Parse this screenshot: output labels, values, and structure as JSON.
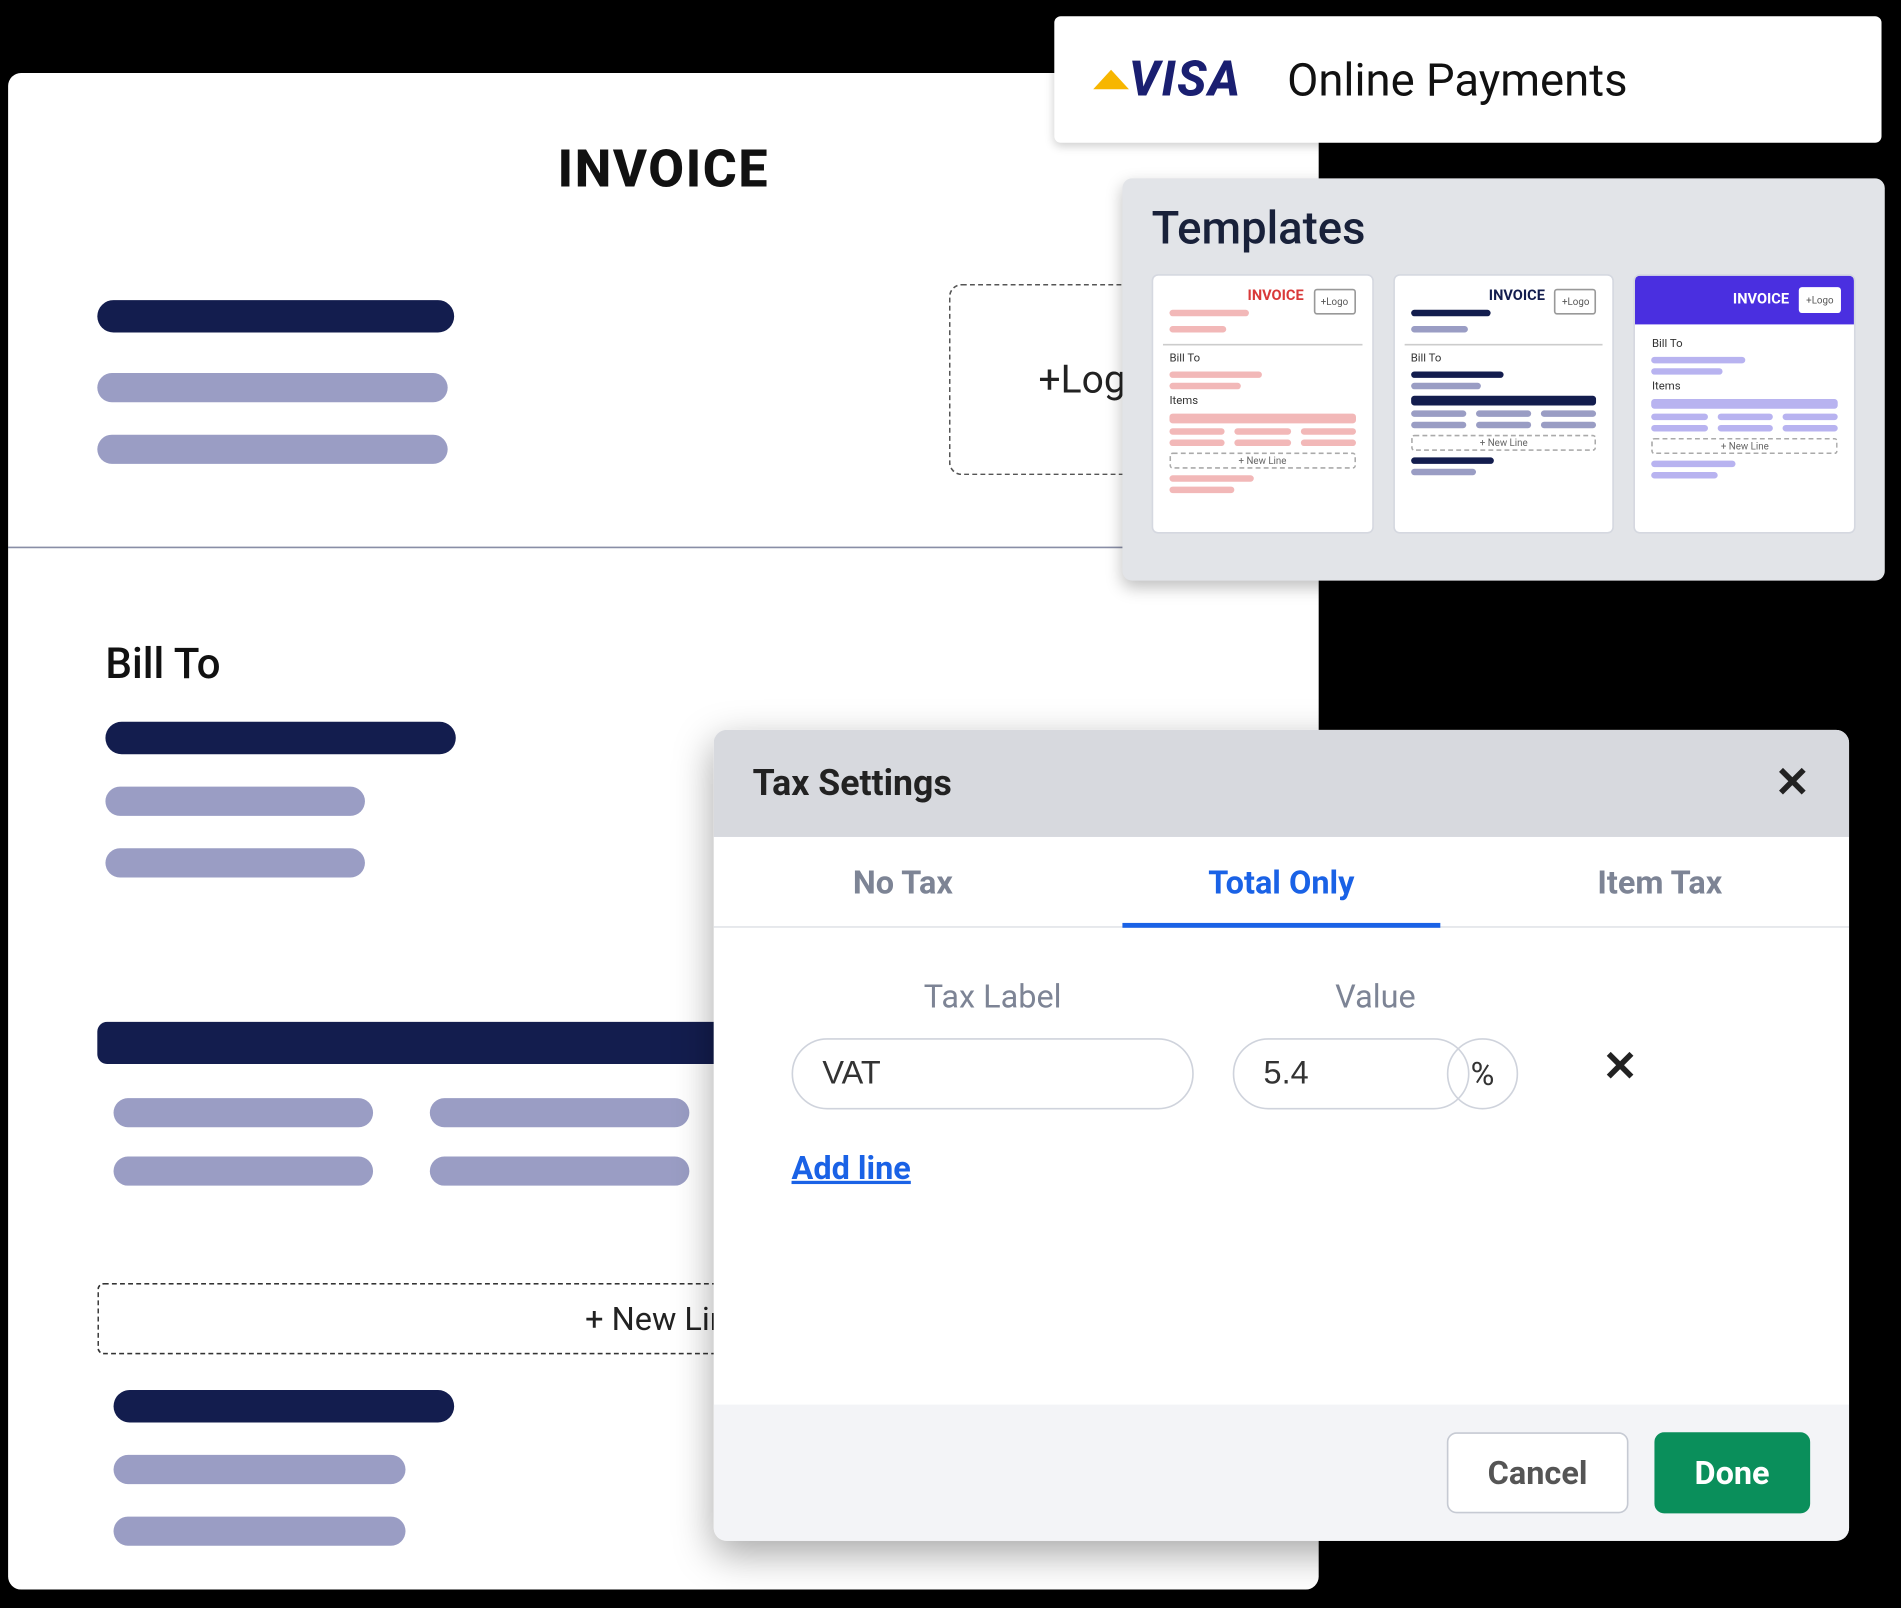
{
  "invoice": {
    "title": "INVOICE",
    "logo_button": "+Logo",
    "bill_to_label": "Bill To",
    "new_line_button": "+ New Line"
  },
  "visa_banner": {
    "brand": "VISA",
    "label": "Online Payments"
  },
  "templates_panel": {
    "title": "Templates",
    "tpl_invoice_label": "INVOICE",
    "tpl_logo_label": "+Logo",
    "tpl_billto_label": "Bill To",
    "tpl_newline_label": "+ New Line"
  },
  "tax_modal": {
    "title": "Tax Settings",
    "tabs": {
      "no_tax": "No Tax",
      "total_only": "Total Only",
      "item_tax": "Item Tax"
    },
    "labels": {
      "tax_label": "Tax Label",
      "value": "Value"
    },
    "row": {
      "label_value": "VAT",
      "value_value": "5.4",
      "unit": "%"
    },
    "add_line": "Add line",
    "buttons": {
      "cancel": "Cancel",
      "done": "Done"
    }
  }
}
